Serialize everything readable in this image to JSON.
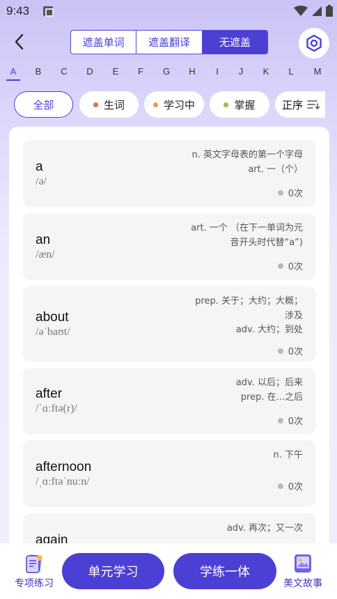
{
  "status": {
    "time": "9:43"
  },
  "tabs": [
    {
      "label": "遮盖单词",
      "active": false
    },
    {
      "label": "遮盖翻译",
      "active": false
    },
    {
      "label": "无遮盖",
      "active": true
    }
  ],
  "alphabet": [
    "A",
    "B",
    "C",
    "D",
    "E",
    "F",
    "G",
    "H",
    "I",
    "J",
    "K",
    "L",
    "M"
  ],
  "selected_letter": "A",
  "filters": {
    "all": "全部",
    "new": "生词",
    "learning": "学习中",
    "mastered": "掌握",
    "order": "正序"
  },
  "colors": {
    "accent": "#4c3fd4",
    "new_dot": "#e8694f",
    "learning_dot": "#f0944a",
    "mastered_dot": "#8cc63f"
  },
  "words": [
    {
      "word": "a",
      "phonetic": "/ə/",
      "defs": [
        "n. 英文字母表的第一个字母",
        "art. 一（个）"
      ],
      "count": "0次"
    },
    {
      "word": "an",
      "phonetic": "/æn/",
      "defs": [
        "art. 一个 （在下一单词为元",
        "音开头时代替“a”)"
      ],
      "count": "0次"
    },
    {
      "word": "about",
      "phonetic": "/əˈbaʊt/",
      "defs": [
        "prep. 关于；大约；大概；",
        "涉及",
        "adv. 大约；到处"
      ],
      "count": "0次"
    },
    {
      "word": "after",
      "phonetic": "/ˈɑːftə(r)/",
      "defs": [
        "adv. 以后；后来",
        "prep. 在...之后"
      ],
      "count": "0次"
    },
    {
      "word": "afternoon",
      "phonetic": "/ˌɑːftəˈnuːn/",
      "defs": [
        "n. 下午"
      ],
      "count": "0次"
    },
    {
      "word": "again",
      "phonetic": "",
      "defs": [
        "adv. 再次；又一次"
      ],
      "count": ""
    }
  ],
  "bottom": {
    "practice": "专项练习",
    "unit_study": "单元学习",
    "study_practice": "学练一体",
    "stories": "美文故事"
  }
}
